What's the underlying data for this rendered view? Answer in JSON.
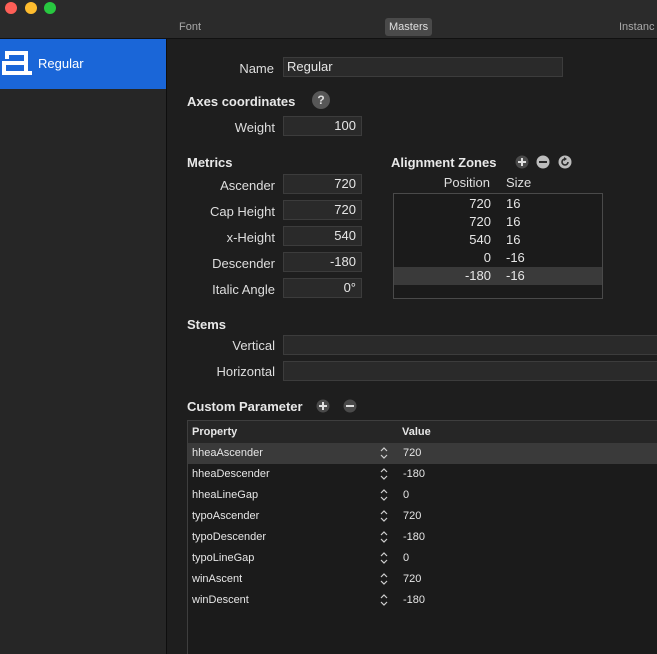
{
  "window": {
    "tabs": [
      {
        "label": "Font"
      },
      {
        "label": "Masters"
      },
      {
        "label": "Instanc"
      }
    ]
  },
  "sidebar": {
    "items": [
      {
        "label": "Regular",
        "icon": "letter-a-icon"
      }
    ]
  },
  "master": {
    "name_label": "Name",
    "name_value": "Regular",
    "axes_title": "Axes coordinates",
    "help_label": "?",
    "weight_label": "Weight",
    "weight_value": "100"
  },
  "metrics": {
    "title": "Metrics",
    "fields": [
      {
        "label": "Ascender",
        "value": "720"
      },
      {
        "label": "Cap Height",
        "value": "720"
      },
      {
        "label": "x-Height",
        "value": "540"
      },
      {
        "label": "Descender",
        "value": "-180"
      },
      {
        "label": "Italic Angle",
        "value": "0°"
      }
    ]
  },
  "alignment_zones": {
    "title": "Alignment Zones",
    "col_position": "Position",
    "col_size": "Size",
    "rows": [
      {
        "position": "720",
        "size": "16"
      },
      {
        "position": "720",
        "size": "16"
      },
      {
        "position": "540",
        "size": "16"
      },
      {
        "position": "0",
        "size": "-16"
      },
      {
        "position": "-180",
        "size": "-16"
      }
    ],
    "selected_index": 4
  },
  "stems": {
    "title": "Stems",
    "vertical_label": "Vertical",
    "vertical_value": "",
    "horizontal_label": "Horizontal",
    "horizontal_value": ""
  },
  "custom_parameters": {
    "title": "Custom Parameter",
    "col_property": "Property",
    "col_value": "Value",
    "rows": [
      {
        "property": "hheaAscender",
        "value": "720"
      },
      {
        "property": "hheaDescender",
        "value": "-180"
      },
      {
        "property": "hheaLineGap",
        "value": "0"
      },
      {
        "property": "typoAscender",
        "value": "720"
      },
      {
        "property": "typoDescender",
        "value": "-180"
      },
      {
        "property": "typoLineGap",
        "value": "0"
      },
      {
        "property": "winAscent",
        "value": "720"
      },
      {
        "property": "winDescent",
        "value": "-180"
      }
    ],
    "selected_index": 0
  },
  "colors": {
    "selection_blue": "#1a66d8",
    "window_bg": "#1e1e1e",
    "sidebar_bg": "#262626"
  }
}
